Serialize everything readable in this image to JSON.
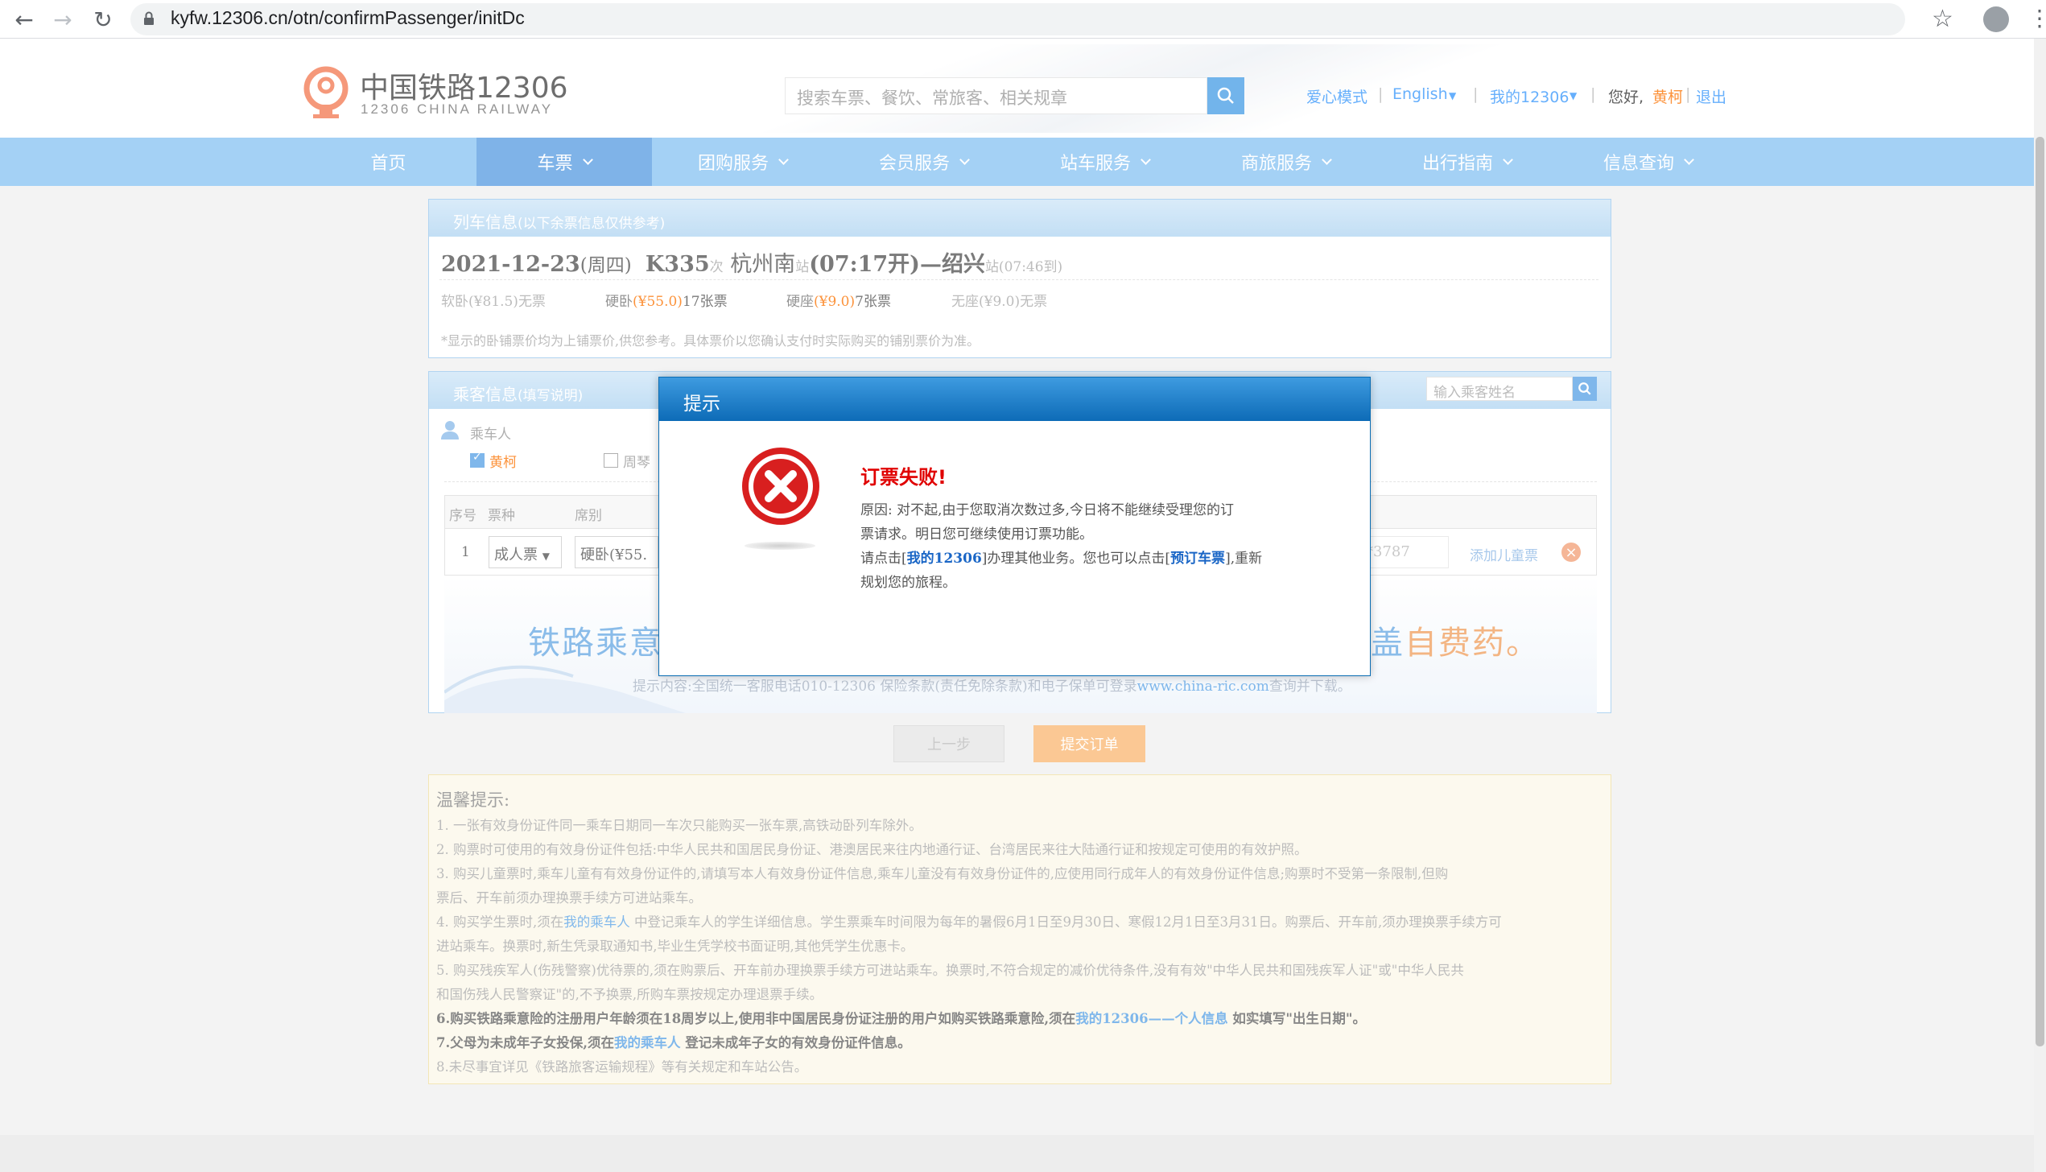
{
  "browser": {
    "url": "kyfw.12306.cn/otn/confirmPassenger/initDc",
    "back_icon": "arrow-back-icon",
    "forward_icon": "arrow-forward-icon",
    "reload_icon": "reload-icon"
  },
  "header": {
    "logo_cn": "中国铁路12306",
    "logo_en": "12306 CHINA RAILWAY",
    "search_placeholder": "搜索车票、餐饮、常旅客、相关规章",
    "links": {
      "care": "爱心模式",
      "english": "English",
      "my12306": "我的12306"
    },
    "hello": "您好,",
    "username": "黄柯",
    "logout": "退出"
  },
  "nav": [
    "首页",
    "车票",
    "团购服务",
    "会员服务",
    "站车服务",
    "商旅服务",
    "出行指南",
    "信息查询"
  ],
  "train_panel": {
    "title": "列车信息",
    "title_note": "(以下余票信息仅供参考)",
    "date": "2021-12-23",
    "weekday": "(周四)",
    "train_no": "K335",
    "ci": "次",
    "from": "杭州南",
    "zhan": "站",
    "dep": "(07:17开)",
    "to": "—绍兴",
    "arr": "站(07:46到)",
    "seats": [
      {
        "name": "软卧",
        "price": "(¥81.5)",
        "avail": "无票"
      },
      {
        "name": "硬卧",
        "price": "(¥55.0)",
        "avail": "17张票"
      },
      {
        "name": "硬座",
        "price": "(¥9.0)",
        "avail": "7张票"
      },
      {
        "name": "无座",
        "price": "(¥9.0)",
        "avail": "无票"
      }
    ],
    "note": "*显示的卧铺票价均为上铺票价,供您参考。具体票价以您确认支付时实际购买的铺别票价为准。"
  },
  "passenger_panel": {
    "title": "乘客信息",
    "title_note": "(填写说明)",
    "search_placeholder": "输入乘客姓名",
    "section_label": "乘车人",
    "passengers": [
      "黄柯",
      "周琴"
    ],
    "columns": [
      "序号",
      "票种",
      "席别"
    ],
    "row": {
      "index": "1",
      "ticket_type": "成人票",
      "seat": "硬卧(¥55.",
      "id_tail": "*3787",
      "add_child": "添加儿童票"
    },
    "banner_left": "铁路乘意",
    "banner_right_a": "盖",
    "banner_right_b": "自费药。",
    "banner_small_a": "提示内容:全国统一客服电话010-12306 保险条款(责任免除条款)和电子保单可登录",
    "banner_small_link": "www.china-ric.com",
    "banner_small_b": "查询并下载。"
  },
  "buttons": {
    "prev": "上一步",
    "submit": "提交订单"
  },
  "tips": {
    "title": "温馨提示:",
    "t1": "1. 一张有效身份证件同一乘车日期同一车次只能购买一张车票,高铁动卧列车除外。",
    "t2": "2. 购票时可使用的有效身份证件包括:中华人民共和国居民身份证、港澳居民来往内地通行证、台湾居民来往大陆通行证和按规定可使用的有效护照。",
    "t3a": "3. 购买儿童票时,乘车儿童有有效身份证件的,请填写本人有效身份证件信息,乘车儿童没有有效身份证件的,应使用同行成年人的有效身份证件信息;购票时不受第一条限制,但购",
    "t3b": "票后、开车前须办理换票手续方可进站乘车。",
    "t4a_pre": "4. 购买学生票时,须在",
    "t4a_link": "我的乘车人",
    "t4a_post": " 中登记乘车人的学生详细信息。学生票乘车时间限为每年的暑假6月1日至9月30日、寒假12月1日至3月31日。购票后、开车前,须办理换票手续方可",
    "t4b": "进站乘车。换票时,新生凭录取通知书,毕业生凭学校书面证明,其他凭学生优惠卡。",
    "t5a": "5. 购买残疾军人(伤残警察)优待票的,须在购票后、开车前办理换票手续方可进站乘车。换票时,不符合规定的减价优待条件,没有有效\"中华人民共和国残疾军人证\"或\"中华人民共",
    "t5b": "和国伤残人民警察证\"的,不予换票,所购车票按规定办理退票手续。",
    "t6_pre": "6.购买铁路乘意险的注册用户年龄须在18周岁以上,使用非中国居民身份证注册的用户如购买铁路乘意险,须在",
    "t6_link": "我的12306——个人信息",
    "t6_post": " 如实填写\"出生日期\"。",
    "t7_pre": "7.父母为未成年子女投保,须在",
    "t7_link": "我的乘车人",
    "t7_post": " 登记未成年子女的有效身份证件信息。",
    "t8": "8.未尽事宜详见《铁路旅客运输规程》等有关规定和车站公告。"
  },
  "dialog": {
    "title": "提示",
    "error_title": "订票失败!",
    "line1": "原因: 对不起,由于您取消次数过多,今日将不能继续受理您的订",
    "line2": "票请求。明日您可继续使用订票功能。",
    "line3_pre": "请点击[",
    "line3_link1": "我的12306",
    "line3_mid": "]办理其他业务。您也可以点击[",
    "line3_link2": "预订车票",
    "line3_post": "],重新",
    "line4": "规划您的旅程。",
    "icon": "error-x-icon"
  },
  "colors": {
    "nav": "#8bc4f2",
    "nav_active": "#5c9ee2",
    "accent_orange": "#fb7403",
    "link_blue": "#3b99fc",
    "error_red": "#e00000"
  }
}
